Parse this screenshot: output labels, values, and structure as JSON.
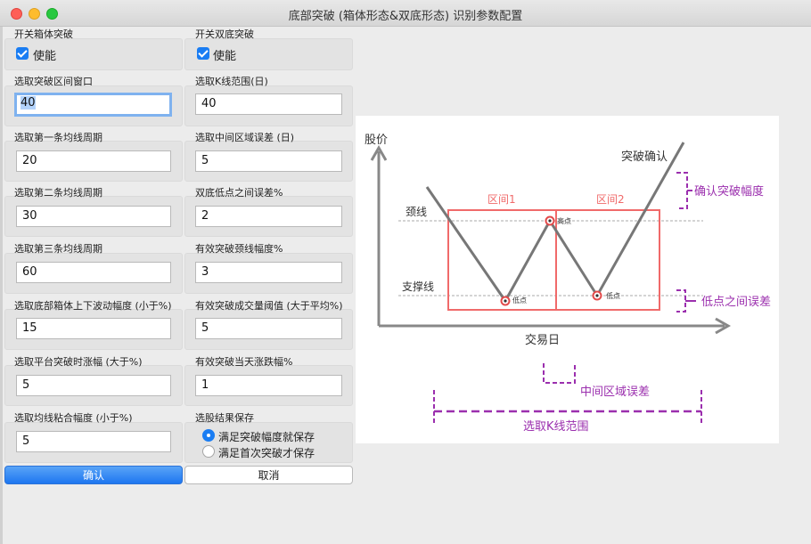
{
  "window": {
    "title": "底部突破 (箱体形态&双底形态) 识别参数配置"
  },
  "left": {
    "box_toggle": {
      "label": "开关箱体突破",
      "checkbox": "使能"
    },
    "window_range": {
      "label": "选取突破区间窗口",
      "value": "40"
    },
    "ma1": {
      "label": "选取第一条均线周期",
      "value": "20"
    },
    "ma2": {
      "label": "选取第二条均线周期",
      "value": "30"
    },
    "ma3": {
      "label": "选取第三条均线周期",
      "value": "60"
    },
    "box_fluct": {
      "label": "选取底部箱体上下波动幅度 (小于%)",
      "value": "15"
    },
    "platform_rise": {
      "label": "选取平台突破时涨幅 (大于%)",
      "value": "5"
    },
    "ma_bond": {
      "label": "选取均线粘合幅度 (小于%)",
      "value": "5"
    }
  },
  "right": {
    "double_toggle": {
      "label": "开关双底突破",
      "checkbox": "使能"
    },
    "k_range": {
      "label": "选取K线范围(日)",
      "value": "40"
    },
    "mid_error": {
      "label": "选取中间区域误差 (日)",
      "value": "5"
    },
    "low_error": {
      "label": "双底低点之间误差%",
      "value": "2"
    },
    "neck_break": {
      "label": "有效突破颈线幅度%",
      "value": "3"
    },
    "vol_threshold": {
      "label": "有效突破成交量阈值 (大于平均%)",
      "value": "5"
    },
    "day_change": {
      "label": "有效突破当天涨跌幅%",
      "value": "1"
    },
    "save_mode": {
      "label": "选股结果保存",
      "options": [
        "满足突破幅度就保存",
        "满足首次突破才保存"
      ],
      "selected": 0
    }
  },
  "buttons": {
    "confirm": "确认",
    "cancel": "取消"
  },
  "diagram": {
    "y_axis": "股价",
    "x_axis": "交易日",
    "breakout": "突破确认",
    "zone1": "区间1",
    "zone2": "区间2",
    "neckline": "颈线",
    "support": "支撑线",
    "high_point": "高点",
    "low_point": "低点",
    "confirm_amp": "确认突破幅度",
    "low_error": "低点之间误差",
    "mid_error": "中间区域误差",
    "k_range": "选取K线范围",
    "colors": {
      "zone": "#f06a6a",
      "annotation": "#9b2fae",
      "line": "#777777"
    }
  }
}
